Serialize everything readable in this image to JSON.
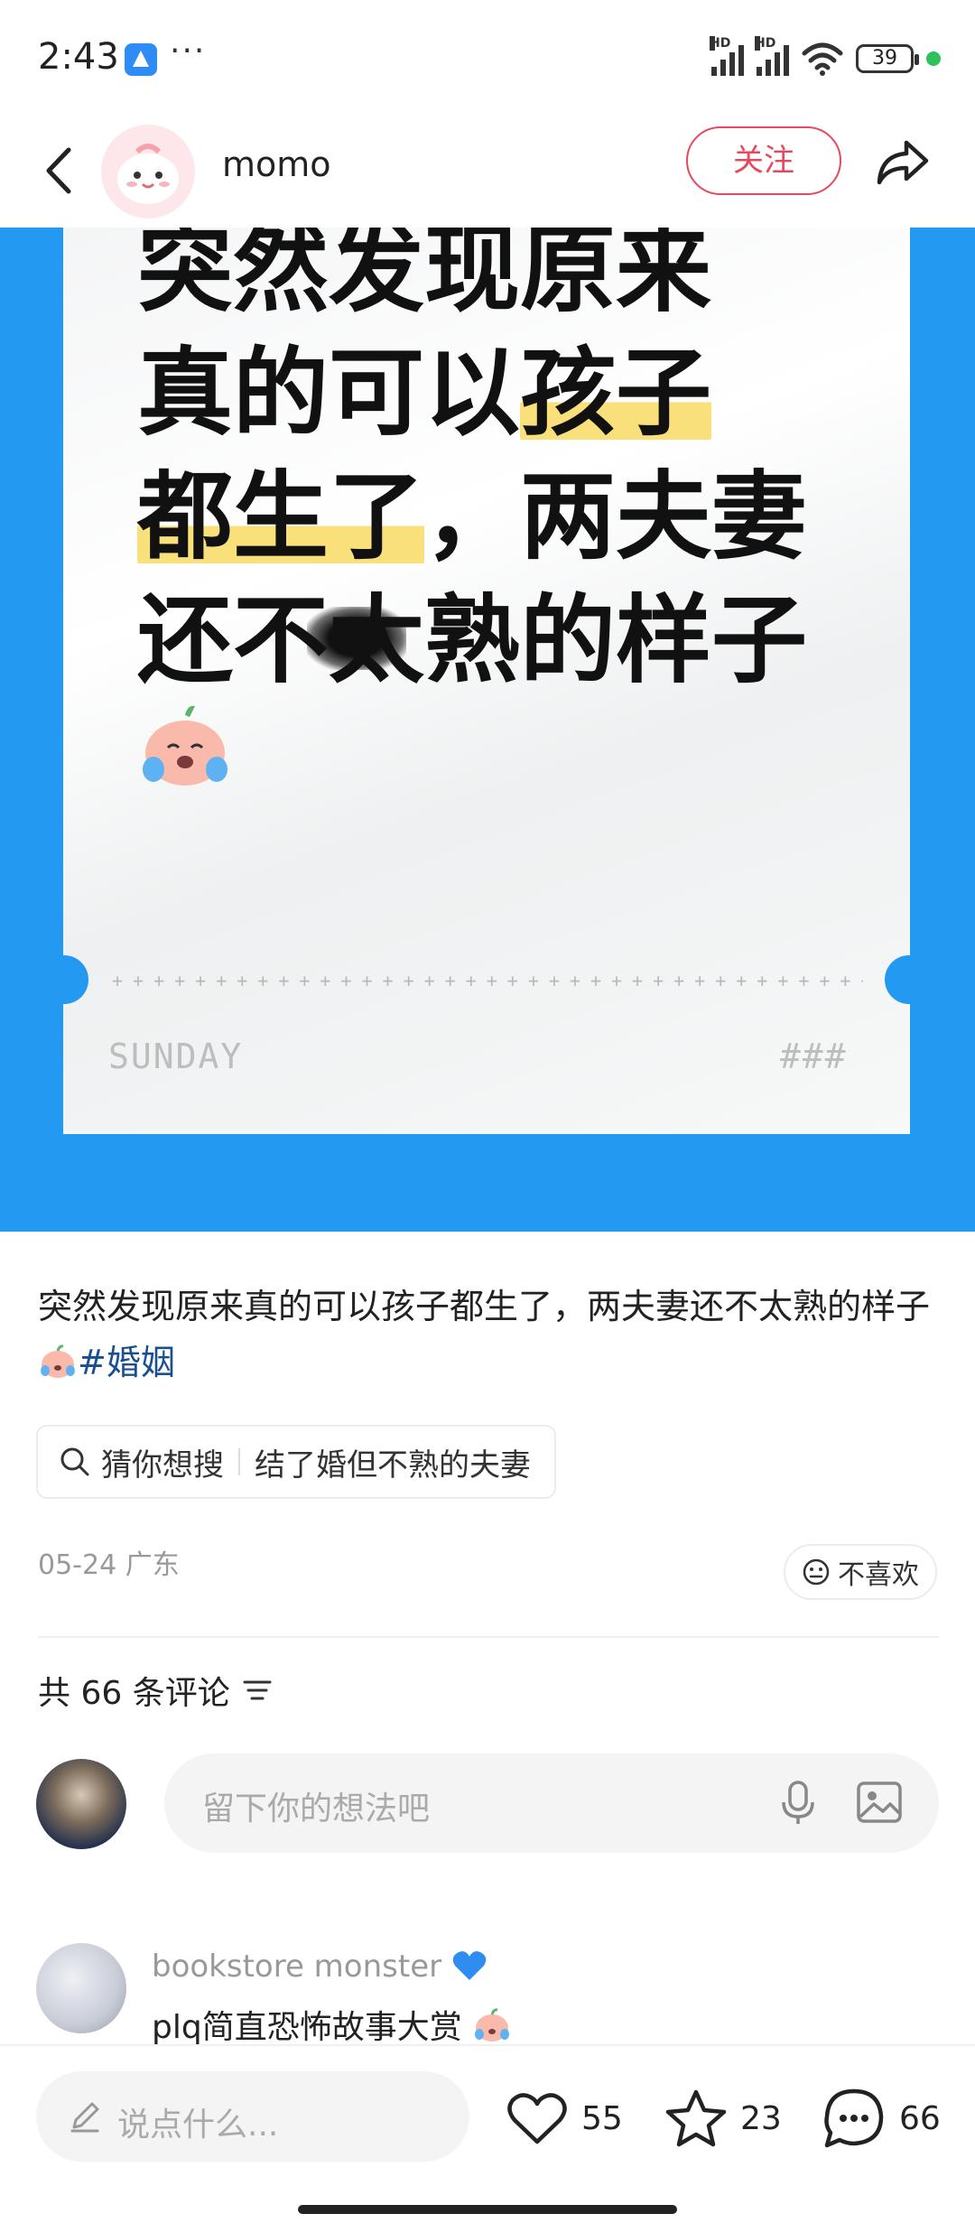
{
  "status_bar": {
    "time": "2:43",
    "dots": "···",
    "network_label_1": "HD",
    "network_label_2": "HD",
    "battery": "39"
  },
  "header": {
    "username": "momo",
    "follow_label": "关注"
  },
  "card": {
    "headline_lines": [
      "突然发现原来",
      "真的可以孩子",
      "都生了，两夫妻",
      "还不太熟的样子"
    ],
    "footer_left": "SUNDAY",
    "footer_right": "###"
  },
  "post": {
    "text": "突然发现原来真的可以孩子都生了，两夫妻还不太熟的样子",
    "hashtag": "#婚姻",
    "search_label": "猜你想搜",
    "search_query": "结了婚但不熟的夫妻",
    "meta": "05-24  广东",
    "dislike_label": "不喜欢"
  },
  "comments": {
    "count_label": "共 66 条评论",
    "input_placeholder": "留下你的想法吧",
    "items": [
      {
        "author": "bookstore monster",
        "text": "plq简直恐怖故事大赏"
      }
    ]
  },
  "bottom_bar": {
    "input_placeholder": "说点什么...",
    "likes": "55",
    "stars": "23",
    "comments": "66"
  },
  "colors": {
    "accent_red": "#e8485e",
    "card_blue": "#2499f2",
    "highlight_yellow": "#f9e07a",
    "hashtag_blue": "#1a4f8f"
  }
}
